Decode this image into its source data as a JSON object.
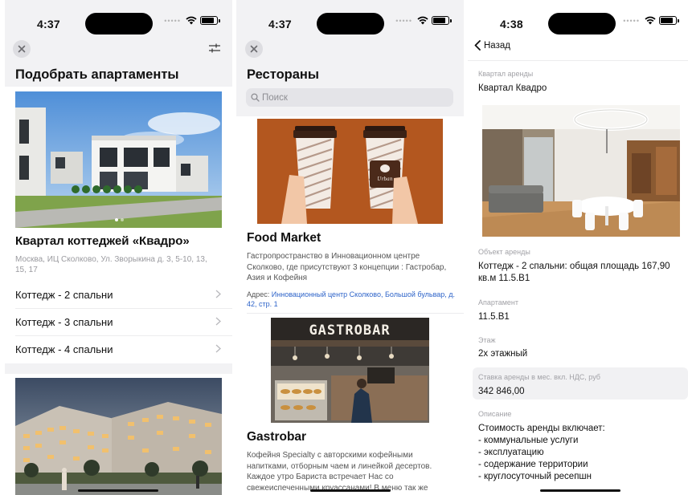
{
  "screens": [
    {
      "status": {
        "time": "4:37"
      },
      "title": "Подобрать апартаменты",
      "card1": {
        "name": "Квартал коттеджей «Квадро»",
        "address": "Москва, ИЦ Сколково, Ул. Зворыкина д. 3, 5-10, 13, 15, 17",
        "options": [
          "Коттедж - 2 спальни",
          "Коттедж - 3 спальни",
          "Коттедж - 4 спальни"
        ]
      },
      "icons": {
        "close": "close-icon",
        "filter": "sliders-icon",
        "chevron": "chevron-right-icon"
      }
    },
    {
      "status": {
        "time": "4:37"
      },
      "title": "Рестораны",
      "search_placeholder": "Поиск",
      "restaurants": [
        {
          "name": "Food Market",
          "description": "Гастропространство в Инновационном центре Сколково, где присутствуют 3 концепции : Гастробар, Азия и Кофейня",
          "address_label": "Адрес: ",
          "address": "Инновационный центр Сколково, Большой бульвар, д. 42, стр. 1",
          "cup_logo": "Urban"
        },
        {
          "name": "Gastrobar",
          "description": "Кофейня Specialty с авторскими кофейными напитками, отборным чаем и линейкой десертов. Каждое утро Бариста встречает Нас со свежеиспеченными круассанами! В меню так же",
          "sign": "GASTROBAR"
        }
      ]
    },
    {
      "status": {
        "time": "4:38"
      },
      "back_label": "Назад",
      "fields": [
        {
          "label": "Квартал аренды",
          "value": "Квартал Квадро"
        },
        {
          "label": "Объект аренды",
          "value": "Коттедж - 2 спальни: общая площадь 167,90 кв.м 11.5.В1"
        },
        {
          "label": "Апартамент",
          "value": "11.5.В1"
        },
        {
          "label": "Этаж",
          "value": "2х этажный"
        },
        {
          "label": "Ставка аренды в мес. вкл. НДС, руб",
          "value": "342 846,00"
        },
        {
          "label": "Описание",
          "value_lines": [
            "Стоимость аренды включает:",
            "- коммунальные услуги",
            "- эксплуатацию",
            "- содержание территории",
            "- круглосуточный ресепшн"
          ]
        }
      ]
    }
  ],
  "colors": {
    "sheet_gray": "#f2f2f4",
    "link_blue": "#2e64c9",
    "secondary_text": "#9a9a9f"
  }
}
